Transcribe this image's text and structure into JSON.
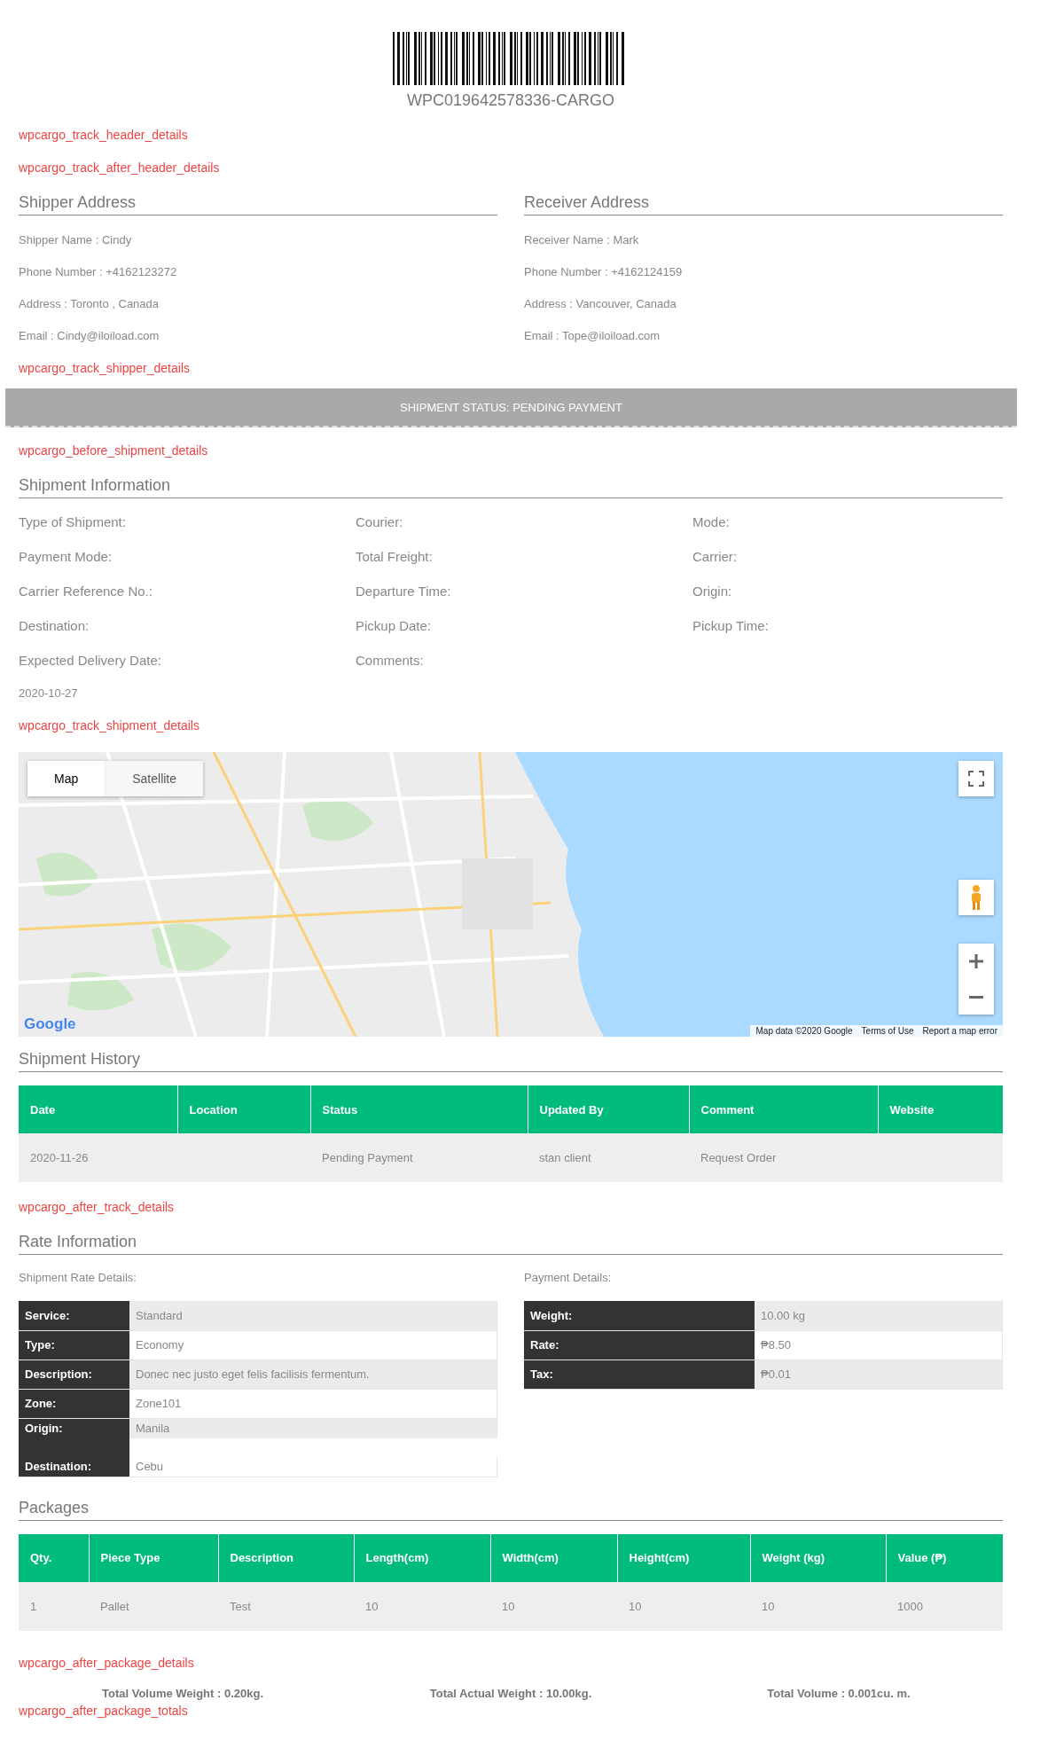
{
  "barcode": {
    "code": "WPC019642578336-CARGO"
  },
  "top_hooks": [
    "wpcargo_track_header_details",
    "wpcargo_track_after_header_details"
  ],
  "addresses": [
    {
      "title": "Shipper Address",
      "lines": [
        "Shipper Name : Cindy",
        "Phone Number : +4162123272",
        "Address : Toronto , Canada",
        "Email : Cindy@iloiload.com"
      ]
    },
    {
      "title": "Receiver Address",
      "lines": [
        "Receiver Name : Mark",
        "Phone Number : +4162124159",
        "Address : Vancouver, Canada",
        "Email : Tope@iloiload.com"
      ]
    }
  ],
  "shipper_hook": "wpcargo_track_shipper_details",
  "status_bar": "SHIPMENT STATUS: PENDING PAYMENT",
  "before_shipment_hook": "wpcargo_before_shipment_details",
  "shipment_information": {
    "title": "Shipment Information",
    "fields": [
      "Type of Shipment:",
      "Courier:",
      "Mode:",
      "Payment Mode:",
      "Total Freight:",
      "Carrier:",
      "Carrier Reference No.:",
      "Departure Time:",
      "Origin:",
      "Destination:",
      "Pickup Date:",
      "Pickup Time:",
      "Expected Delivery Date:",
      "Comments:"
    ],
    "date": "2020-10-27",
    "hook": "wpcargo_track_shipment_details"
  },
  "map": {
    "kind": "picture",
    "map_types": [
      {
        "label": "Map",
        "selected": true
      },
      {
        "label": "Satellite",
        "selected": false
      }
    ],
    "logo": "Google",
    "attribution": [
      "Map data ©2020 Google",
      "Terms of Use",
      "Report a map error"
    ]
  },
  "shipment_history": {
    "title": "Shipment History",
    "columns": [
      "Date",
      "Location",
      "Status",
      "Updated By",
      "Comment",
      "Website"
    ],
    "rows": [
      [
        "2020-11-26",
        null,
        "Pending Payment",
        "stan client",
        "Request Order",
        null
      ]
    ]
  },
  "after_track_hook": "wpcargo_after_track_details",
  "rate_information": {
    "title": "Rate Information",
    "tables": [
      {
        "title": "Shipment Rate Details:",
        "rows": [
          {
            "label": "Service:",
            "value": "Standard"
          },
          {
            "label": "Type:",
            "value": "Economy"
          },
          {
            "label": "Description:",
            "value": "Donec nec justo eget felis facilisis fermentum."
          },
          {
            "label": "Zone:",
            "value": "Zone101"
          },
          {
            "label": "Origin:",
            "value": "Manila"
          },
          {
            "label": "Destination:",
            "value": "Cebu"
          }
        ]
      },
      {
        "title": "Payment Details:",
        "rows": [
          {
            "label": "Weight:",
            "value": "10.00 kg"
          },
          {
            "label": "Rate:",
            "value": "₱8.50"
          },
          {
            "label": "Tax:",
            "value": "₱0.01"
          }
        ]
      }
    ]
  },
  "packages": {
    "title": "Packages",
    "columns": [
      "Qty.",
      "Piece Type",
      "Description",
      "Length(cm)",
      "Width(cm)",
      "Height(cm)",
      "Weight (kg)",
      "Value (₱)"
    ],
    "rows": [
      [
        "1",
        "Pallet",
        "Test",
        "10",
        "10",
        "10",
        "10",
        "1000"
      ]
    ],
    "hook": "wpcargo_after_package_details",
    "totals": [
      "Total Volume Weight : 0.20kg.",
      "Total Actual Weight : 10.00kg.",
      "Total Volume : 0.001cu. m."
    ],
    "totals_hook": "wpcargo_after_package_totals"
  }
}
